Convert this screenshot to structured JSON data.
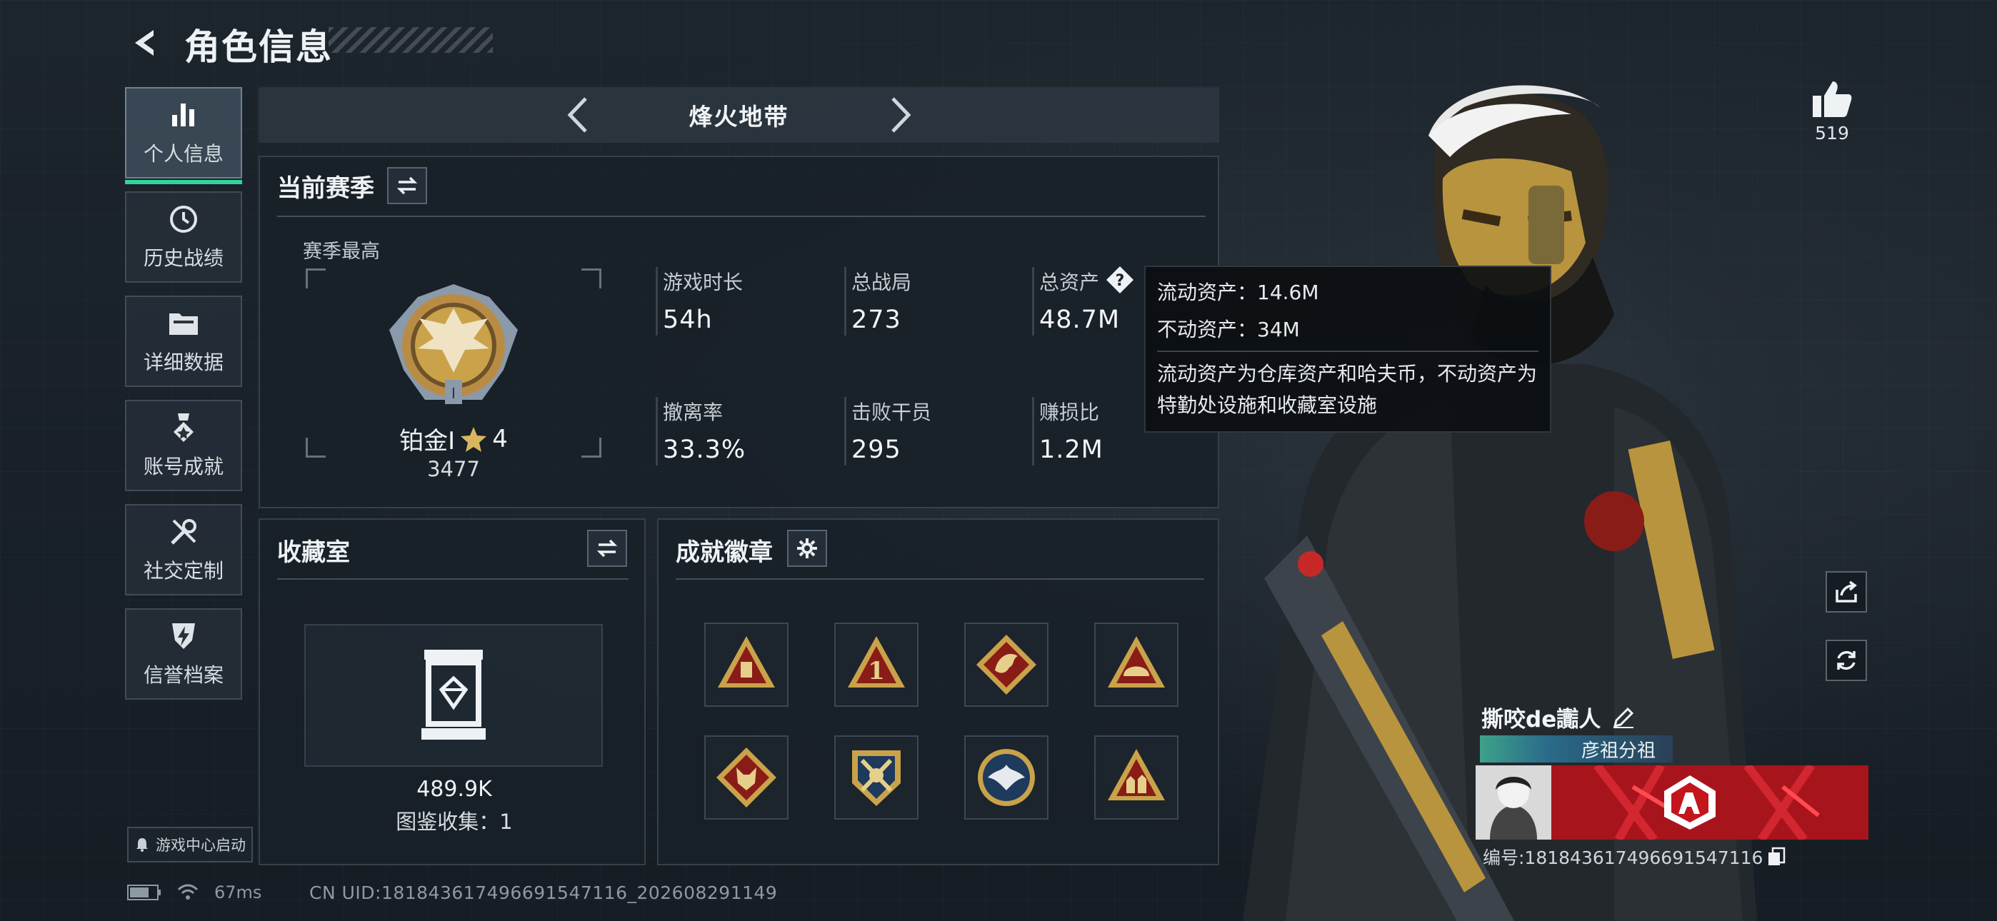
{
  "header": {
    "title": "角色信息"
  },
  "sidebar": {
    "items": [
      {
        "label": "个人信息",
        "icon": "bar-chart-icon",
        "active": true
      },
      {
        "label": "历史战绩",
        "icon": "history-clock-icon"
      },
      {
        "label": "详细数据",
        "icon": "folder-icon"
      },
      {
        "label": "账号成就",
        "icon": "medal-icon"
      },
      {
        "label": "社交定制",
        "icon": "wrench-screwdriver-icon"
      },
      {
        "label": "信誉档案",
        "icon": "shield-bolt-icon"
      }
    ],
    "launch_label": "游戏中心启动"
  },
  "mode": {
    "name": "烽火地带"
  },
  "current_season": {
    "title": "当前赛季",
    "subtitle": "赛季最高",
    "rank_name": "铂金Ⅰ",
    "rank_stars": "4",
    "rank_score": "3477",
    "stats": [
      {
        "label": "游戏时长",
        "value": "54h"
      },
      {
        "label": "总战局",
        "value": "273"
      },
      {
        "label": "总资产",
        "value": "48.7M"
      },
      {
        "label": "撤离率",
        "value": "33.3%"
      },
      {
        "label": "击败干员",
        "value": "295"
      },
      {
        "label": "赚损比",
        "value": "1.2M"
      }
    ]
  },
  "tooltip": {
    "liquid": "流动资产：14.6M",
    "fixed": "不动资产：34M",
    "description": "流动资产为仓库资产和哈夫币，不动资产为特勤处设施和收藏室设施"
  },
  "collection": {
    "title": "收藏室",
    "value": "489.9K",
    "count_text": "图鉴收集：1"
  },
  "badges": {
    "title": "成就徽章",
    "items": [
      "triangle-badge-icon",
      "number-one-badge-icon",
      "dragon-badge-icon",
      "helmet-badge-icon",
      "wolf-badge-icon",
      "crossed-rifles-badge-icon",
      "eagle-badge-icon",
      "soldiers-badge-icon"
    ]
  },
  "status": {
    "ping": "67ms"
  },
  "uid": "CN UID:181843617496691547116_202608291149",
  "profile": {
    "likes": "519",
    "name": "撕咬de讟人",
    "clan": "彦祖分祖",
    "id_text": "编号:181843617496691547116"
  },
  "colors": {
    "accent": "#34d399",
    "gold": "#c9a24a",
    "badge_red": "#8a1c18"
  }
}
